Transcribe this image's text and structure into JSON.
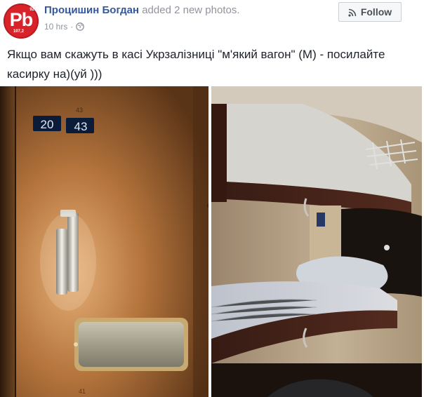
{
  "post": {
    "author": "Процишин Богдан",
    "action": "added 2 new photos.",
    "time": "10 hrs",
    "privacy_icon": "globe-icon",
    "follow_label": "Follow",
    "text_line1": "Якщо вам скажуть в касі Укрзалізниці \"м'який вагон\" (М) - посилайте",
    "text_line2": "касирку на)(уй )))"
  },
  "avatar": {
    "logo_text": "Pb",
    "logo_num_top": "92",
    "logo_num_bottom": "107,2"
  },
  "photos": {
    "left": {
      "plate_1": "20",
      "plate_2": "43",
      "scribble_top": "43",
      "scribble_bottom": "41"
    },
    "right": {}
  },
  "colors": {
    "author_link": "#365899",
    "muted": "#90949c",
    "avatar_red": "#d8232a"
  }
}
